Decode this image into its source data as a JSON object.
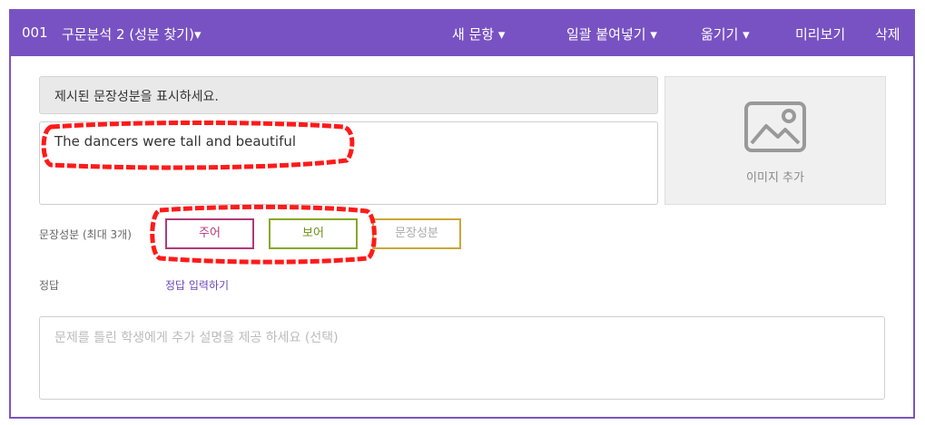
{
  "header": {
    "number": "001",
    "question_title": "구문분석 2 (성분 찾기)▾",
    "menu": {
      "new_question": "새 문항 ▾",
      "bulk_paste": "일괄 붙여넣기 ▾",
      "move": "옮기기 ▾",
      "preview": "미리보기",
      "delete": "삭제"
    }
  },
  "question": {
    "prompt": "제시된 문장성분을 표시하세요.",
    "sentence": "The dancers were tall and beautiful"
  },
  "image": {
    "label": "이미지 추가",
    "icon": "image-icon"
  },
  "components": {
    "label": "문장성분 (최대 3개)",
    "items": [
      "주어",
      "보어",
      "문장성분"
    ]
  },
  "answer": {
    "label": "정답",
    "link": "정답 입력하기"
  },
  "explanation": {
    "placeholder": "문제를 틀린 학생에게 추가 설명을 제공 하세요 (선택)"
  },
  "colors": {
    "header": "#7852c2",
    "chip_subject": "#b03a78",
    "chip_complement": "#87a82a",
    "chip_empty": "#c9a838",
    "annotation": "#ff1a1a"
  }
}
